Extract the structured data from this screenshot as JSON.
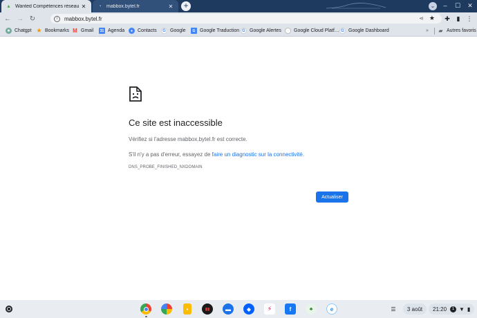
{
  "tabs": [
    {
      "title": "Wanted Compétences réseau - Bo…",
      "active": true
    },
    {
      "title": "mabbox.bytel.fr",
      "active": false
    }
  ],
  "toolbar": {
    "url": "mabbox.bytel.fr"
  },
  "bookmarks": [
    {
      "label": "Chatgpt"
    },
    {
      "label": "Bookmarks"
    },
    {
      "label": "Gmail"
    },
    {
      "label": "Agenda"
    },
    {
      "label": "Contacts"
    },
    {
      "label": "Google"
    },
    {
      "label": "Google Traduction"
    },
    {
      "label": "Google Alertes"
    },
    {
      "label": "Google Cloud Platf…"
    },
    {
      "label": "Google Dashboard"
    }
  ],
  "bookmarks_other": "Autres favoris",
  "error": {
    "title": "Ce site est inaccessible",
    "line1": "Vérifiez si l'adresse mabbox.bytel.fr est correcte.",
    "line2_prefix": "S'il n'y a pas d'erreur, essayez de ",
    "line2_link": "faire un diagnostic sur la connectivité",
    "line2_suffix": ".",
    "code": "DNS_PROBE_FINISHED_NXDOMAIN",
    "reload_label": "Actualiser"
  },
  "shelf": {
    "date": "3 août",
    "time": "21:20",
    "notification_count": "1"
  },
  "colors": {
    "tabstrip": "#1f3a5f",
    "toolbar": "#dfe3ea",
    "link": "#1a73e8",
    "button": "#1a73e8"
  }
}
